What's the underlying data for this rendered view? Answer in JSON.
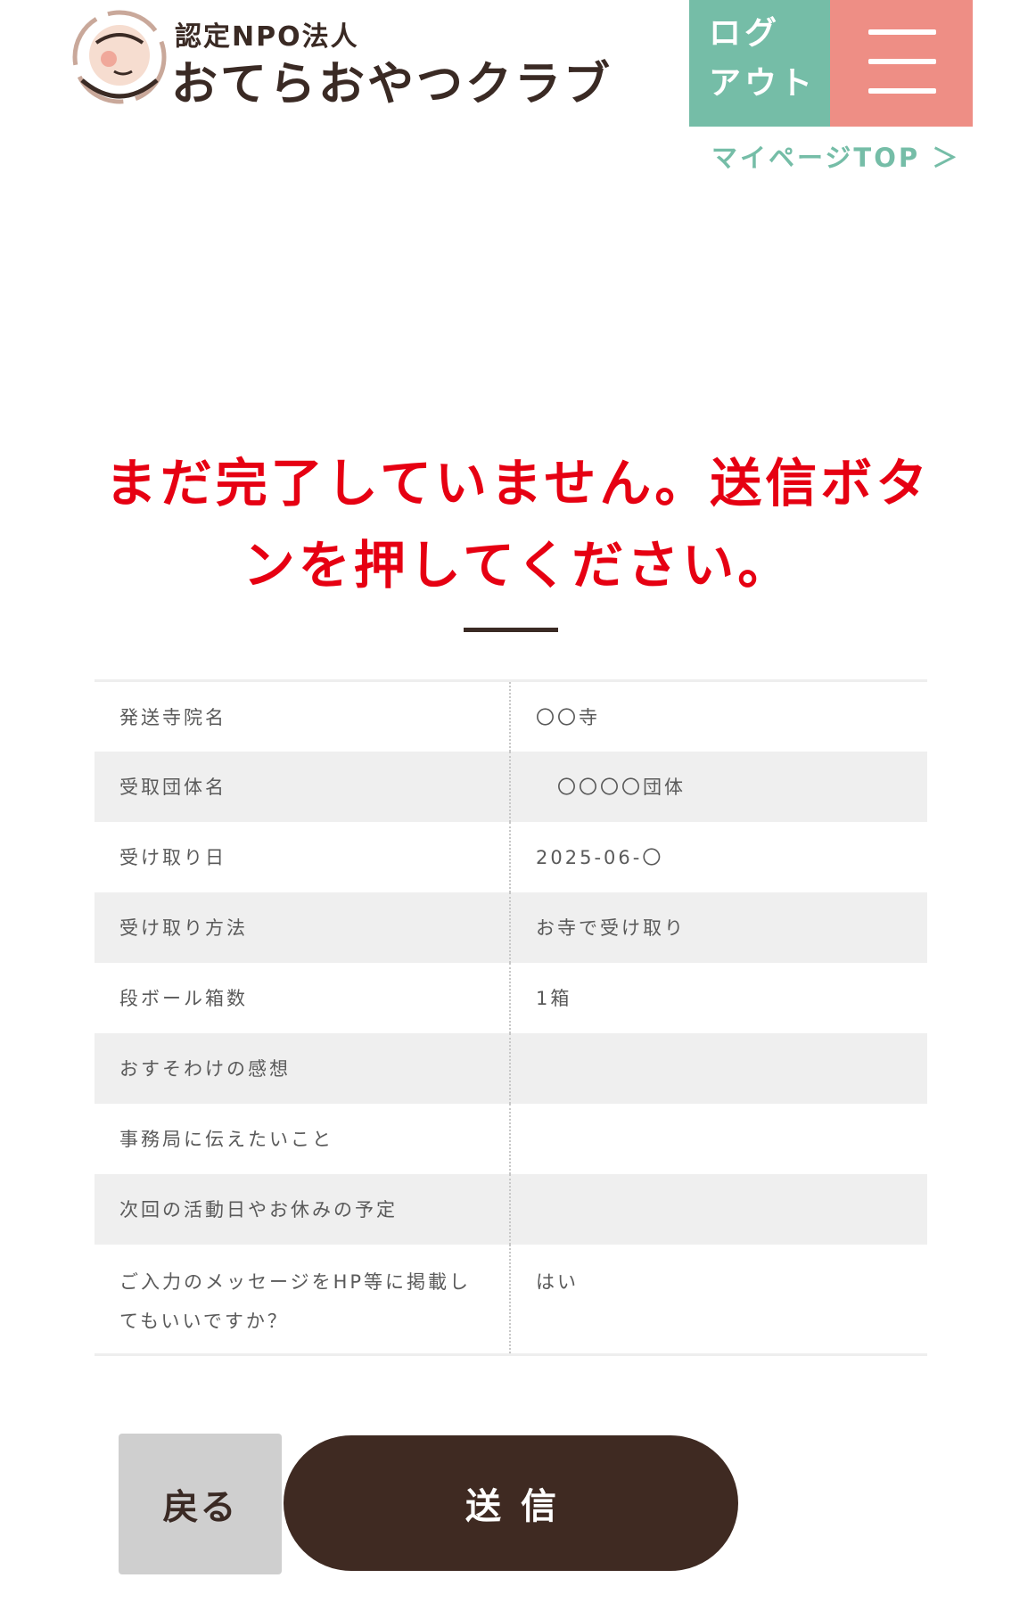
{
  "header": {
    "logo_sub": "認定NPO法人",
    "logo_main": "おてらおやつクラブ",
    "logout_line1": "ログ",
    "logout_line2": "アウト",
    "mypage_link": "マイページTOP ＞"
  },
  "warning": {
    "line1": "まだ完了していません。送信ボタ",
    "line2": "ンを押してください。"
  },
  "table": {
    "rows": [
      {
        "label": "発送寺院名",
        "value": "〇〇寺"
      },
      {
        "label": "受取団体名",
        "value": "　〇〇〇〇団体"
      },
      {
        "label": "受け取り日",
        "value": "2025-06-〇"
      },
      {
        "label": "受け取り方法",
        "value": "お寺で受け取り"
      },
      {
        "label": "段ボール箱数",
        "value": "1箱"
      },
      {
        "label": "おすそわけの感想",
        "value": ""
      },
      {
        "label": "事務局に伝えたいこと",
        "value": ""
      },
      {
        "label": "次回の活動日やお休みの予定",
        "value": ""
      },
      {
        "label": "ご入力のメッセージをHP等に掲載してもいいですか？",
        "value": "はい"
      }
    ]
  },
  "actions": {
    "back_label": "戻る",
    "submit_label": "送信"
  },
  "colors": {
    "logout_bg": "#75bda7",
    "menu_bg": "#ee8e85",
    "warning_text": "#e60012",
    "submit_bg": "#3f2a22",
    "back_bg": "#cfcfcf"
  },
  "icons": {
    "logo": "otera-oyatsu-club-logo-icon",
    "menu": "hamburger-menu-icon"
  }
}
